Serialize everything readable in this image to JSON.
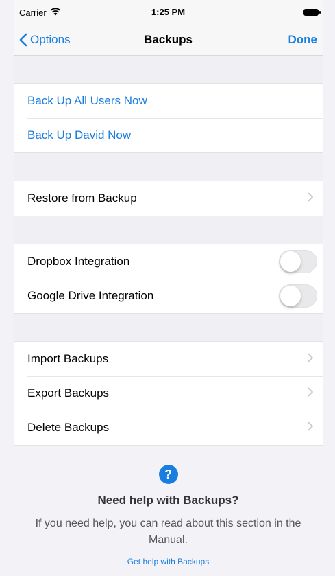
{
  "status_bar": {
    "carrier": "Carrier",
    "time": "1:25 PM"
  },
  "nav": {
    "back_label": "Options",
    "title": "Backups",
    "done_label": "Done"
  },
  "groups": {
    "backup_now": [
      {
        "label": "Back Up All Users Now"
      },
      {
        "label": "Back Up David Now"
      }
    ],
    "restore": [
      {
        "label": "Restore from Backup"
      }
    ],
    "integrations": [
      {
        "label": "Dropbox Integration",
        "enabled": false
      },
      {
        "label": "Google Drive Integration",
        "enabled": false
      }
    ],
    "manage": [
      {
        "label": "Import Backups"
      },
      {
        "label": "Export Backups"
      },
      {
        "label": "Delete Backups"
      }
    ]
  },
  "help": {
    "icon": "question-mark",
    "title": "Need help with Backups?",
    "text": "If you need help, you can read about this section in the Manual.",
    "link": "Get help with Backups"
  },
  "colors": {
    "accent": "#1a7ee0",
    "background": "#f2f2f7",
    "chevron": "#c7c7cc"
  }
}
